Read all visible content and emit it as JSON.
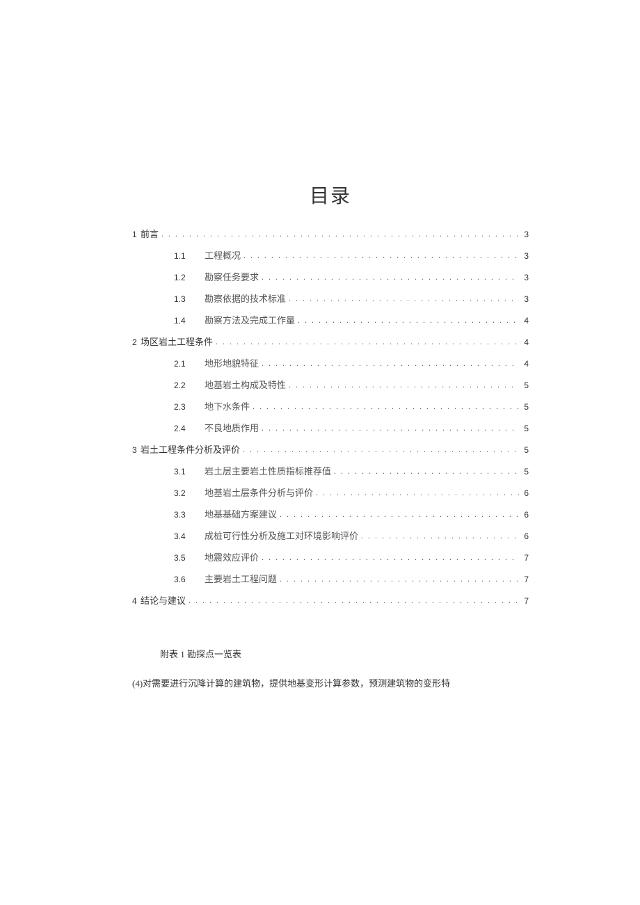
{
  "title": "目录",
  "toc": [
    {
      "level": 1,
      "num": "1",
      "text": "前言",
      "page": "3"
    },
    {
      "level": 2,
      "num": "1.1",
      "text": "工程概况",
      "page": "3"
    },
    {
      "level": 2,
      "num": "1.2",
      "text": "勘察任务要求",
      "page": "3"
    },
    {
      "level": 2,
      "num": "1.3",
      "text": "勘察依据的技术标准",
      "page": "3"
    },
    {
      "level": 2,
      "num": "1.4",
      "text": "勘察方法及完成工作量",
      "page": "4"
    },
    {
      "level": 1,
      "num": "2",
      "text": "场区岩土工程条件",
      "page": "4"
    },
    {
      "level": 2,
      "num": "2.1",
      "text": "地形地貌特征",
      "page": "4"
    },
    {
      "level": 2,
      "num": "2.2",
      "text": "地基岩土构成及特性",
      "page": "5"
    },
    {
      "level": 2,
      "num": "2.3",
      "text": "地下水条件",
      "page": "5"
    },
    {
      "level": 2,
      "num": "2.4",
      "text": "不良地质作用",
      "page": "5"
    },
    {
      "level": 1,
      "num": "3",
      "text": "岩土工程条件分析及评价",
      "page": "5"
    },
    {
      "level": 2,
      "num": "3.1",
      "text": "岩土层主要岩土性质指标推荐值",
      "page": "5"
    },
    {
      "level": 2,
      "num": "3.2",
      "text": "地基岩土层条件分析与评价",
      "page": "6"
    },
    {
      "level": 2,
      "num": "3.3",
      "text": "地基基础方案建议",
      "page": "6"
    },
    {
      "level": 2,
      "num": "3.4",
      "text": "成桩可行性分析及施工对环境影响评价",
      "page": "6"
    },
    {
      "level": 2,
      "num": "3.5",
      "text": "地震效应评价",
      "page": "7"
    },
    {
      "level": 2,
      "num": "3.6",
      "text": "主要岩土工程问题",
      "page": "7"
    },
    {
      "level": 1,
      "num": "4",
      "text": "结论与建议",
      "page": "7"
    }
  ],
  "appendix": "附表 1 勘探点一览表",
  "footnote": "(4)对需要进行沉降计算的建筑物，提供地基变形计算参数，预测建筑物的变形特"
}
